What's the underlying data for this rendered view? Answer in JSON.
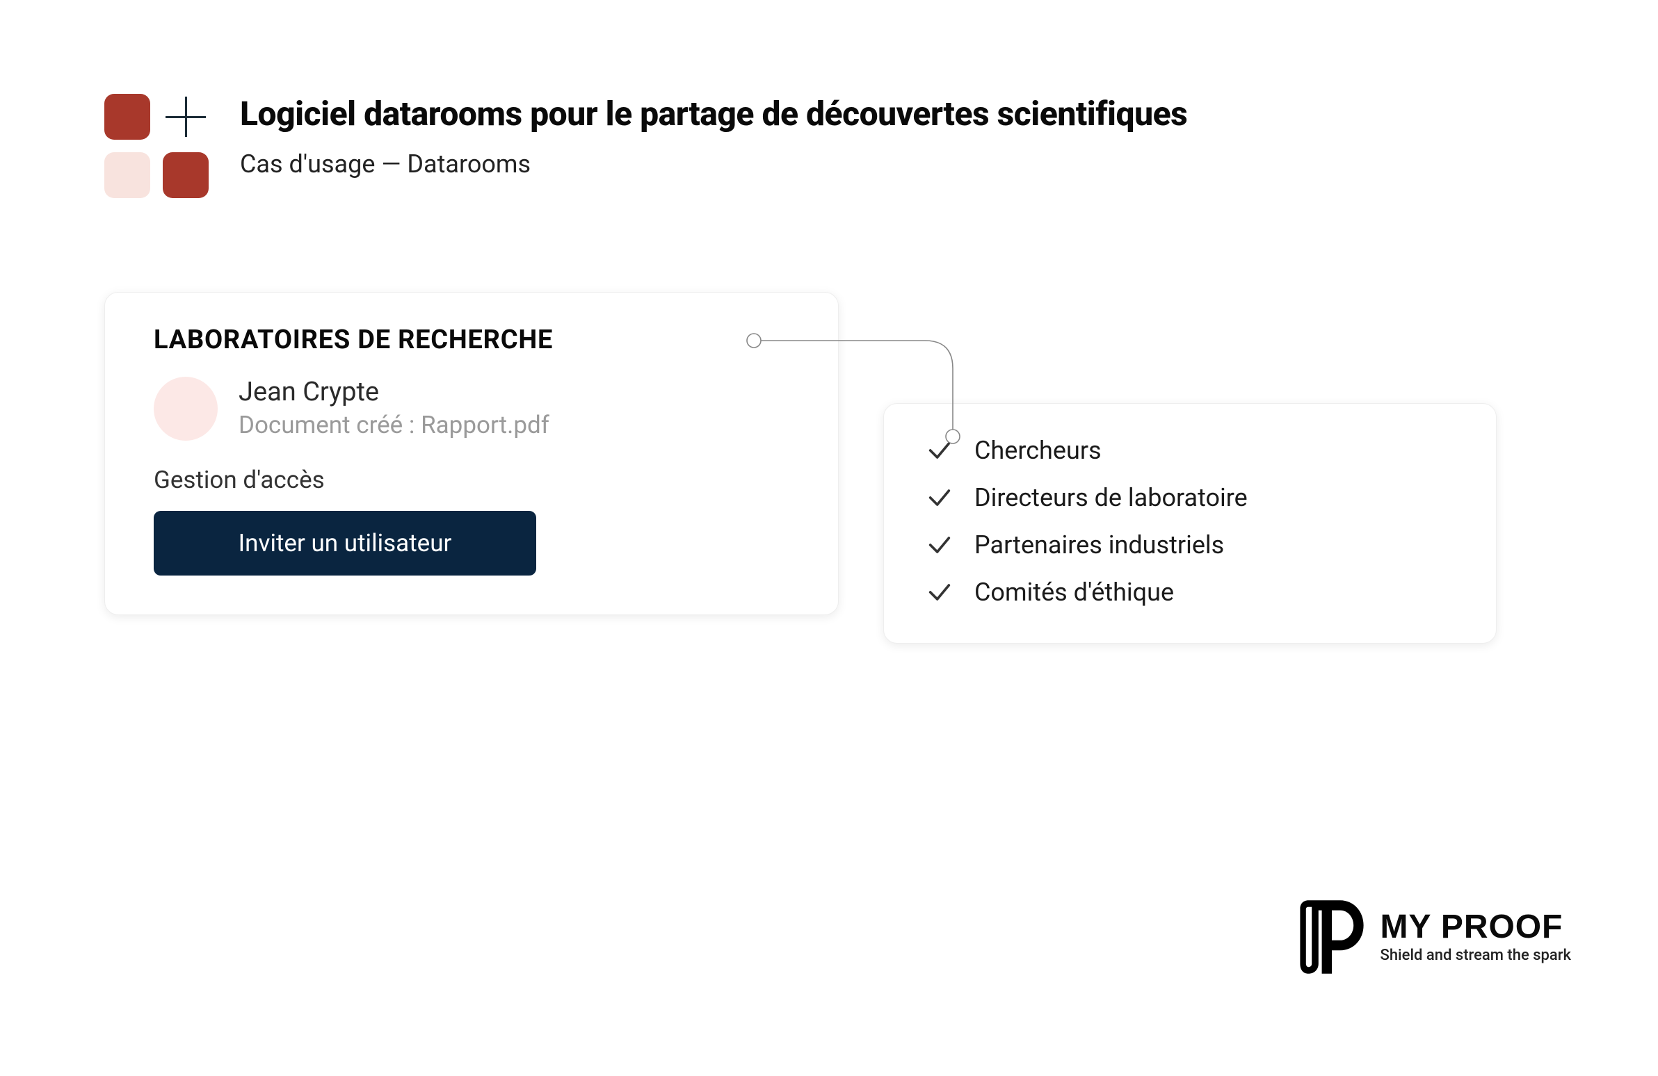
{
  "header": {
    "title": "Logiciel datarooms pour le partage de découvertes scientifiques",
    "subtitle": "Cas d'usage — Datarooms"
  },
  "card_lab": {
    "title": "LABORATOIRES DE RECHERCHE",
    "user_name": "Jean Crypte",
    "user_doc": "Document créé : Rapport.pdf",
    "section_label": "Gestion d'accès",
    "invite_button": "Inviter un utilisateur"
  },
  "roles": {
    "items": [
      "Chercheurs",
      "Directeurs de laboratoire",
      "Partenaires industriels",
      "Comités d'éthique"
    ]
  },
  "footer": {
    "brand": "MY PROOF",
    "tagline": "Shield and stream the spark"
  }
}
